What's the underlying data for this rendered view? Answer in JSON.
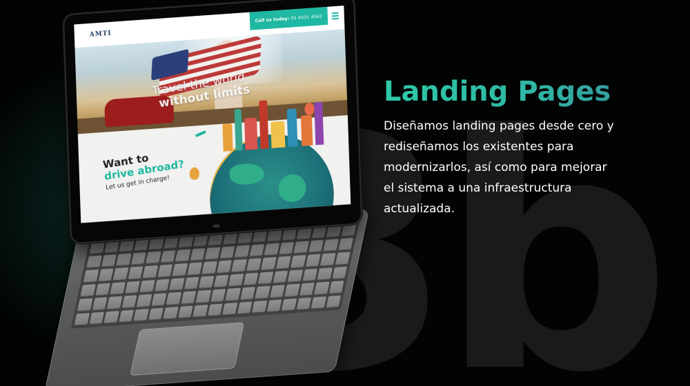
{
  "watermark": {
    "text": "3b."
  },
  "laptop": {
    "site": {
      "logo": "AMTI",
      "call_label": "Call us today:",
      "call_number": "55 4031 4042",
      "hero_line1": "Travel the world",
      "hero_line2": "without limits",
      "cta_line1": "Want to",
      "cta_line2": "drive abroad?",
      "cta_line3": "Let us get in charge!"
    }
  },
  "copy": {
    "headline": "Landing Pages",
    "body_lines": [
      "Diseñamos landing pages desde cero y",
      "rediseñamos los existentes para",
      "modernizarlos, así como para mejorar",
      "el sistema a una infraestructura",
      "actualizada."
    ]
  },
  "colors": {
    "accent": "#2ec9a6",
    "accent_end": "#3a8a98",
    "text": "#ffffff",
    "watermark": "#1a1a1a"
  }
}
